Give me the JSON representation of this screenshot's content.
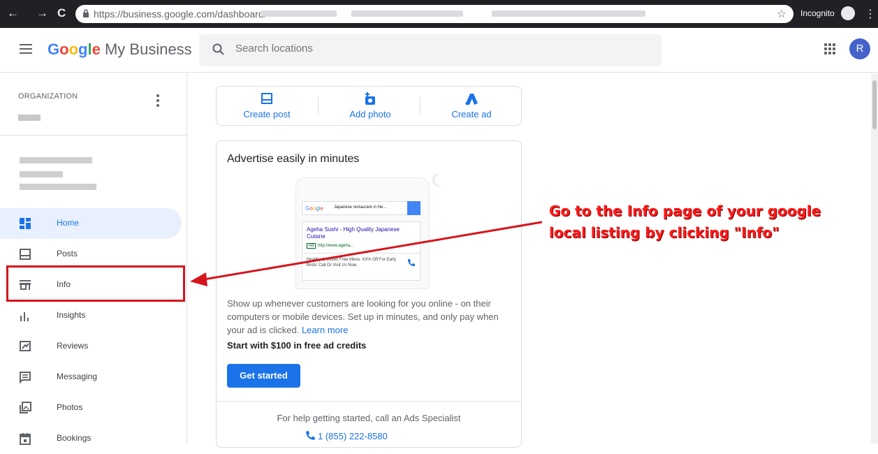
{
  "browser": {
    "url": "https://business.google.com/dashboard/",
    "incognito_label": "Incognito",
    "back_icon": "←",
    "forward_icon": "→",
    "reload_icon": "C",
    "star_icon": "☆",
    "menu_icon": "⋮"
  },
  "app": {
    "logo_google": "Google",
    "logo_rest": " My Business",
    "search_placeholder": "Search locations",
    "avatar_initial": "R",
    "brand_colors": {
      "blue": "#4285f4",
      "red": "#ea4335",
      "yellow": "#fbbc05",
      "green": "#34a853"
    }
  },
  "sidebar": {
    "org_label": "ORGANIZATION",
    "items": [
      {
        "label": "Home",
        "icon": "dashboard-icon",
        "active": true
      },
      {
        "label": "Posts",
        "icon": "posts-icon"
      },
      {
        "label": "Info",
        "icon": "storefront-icon"
      },
      {
        "label": "Insights",
        "icon": "bar-chart-icon"
      },
      {
        "label": "Reviews",
        "icon": "reviews-icon"
      },
      {
        "label": "Messaging",
        "icon": "message-icon"
      },
      {
        "label": "Photos",
        "icon": "photos-icon"
      },
      {
        "label": "Bookings",
        "icon": "calendar-icon"
      }
    ]
  },
  "actions": [
    {
      "label": "Create post",
      "icon": "post-icon"
    },
    {
      "label": "Add photo",
      "icon": "add-photo-icon"
    },
    {
      "label": "Create ad",
      "icon": "google-ads-icon"
    }
  ],
  "ad_card": {
    "title": "Advertise easily in minutes",
    "preview": {
      "search_brand": "Google",
      "search_query": "Japanese restaurant in Ne...",
      "ad_title": "Ageha Sushi - High Quality Japanese Cuisine",
      "ad_tag": "Ad",
      "ad_url": "http://www.ageha...",
      "ad_desc": "Healthy & Gluten Free Menu. XX% Off For Early Birds! Call Or Visit Us Now."
    },
    "body": "Show up whenever customers are looking for you online - on their computers or mobile devices. Set up in minutes, and only pay when your ad is clicked.",
    "learn_more": "Learn more",
    "credits": "Start with $100 in free ad credits",
    "button": "Get started",
    "help_text": "For help getting started, call an Ads Specialist",
    "phone": "1 (855) 222-8580"
  },
  "annotation": {
    "text": "Go to the Info page of your google local listing by clicking \"Info\"",
    "color": "#ff1a1a"
  }
}
